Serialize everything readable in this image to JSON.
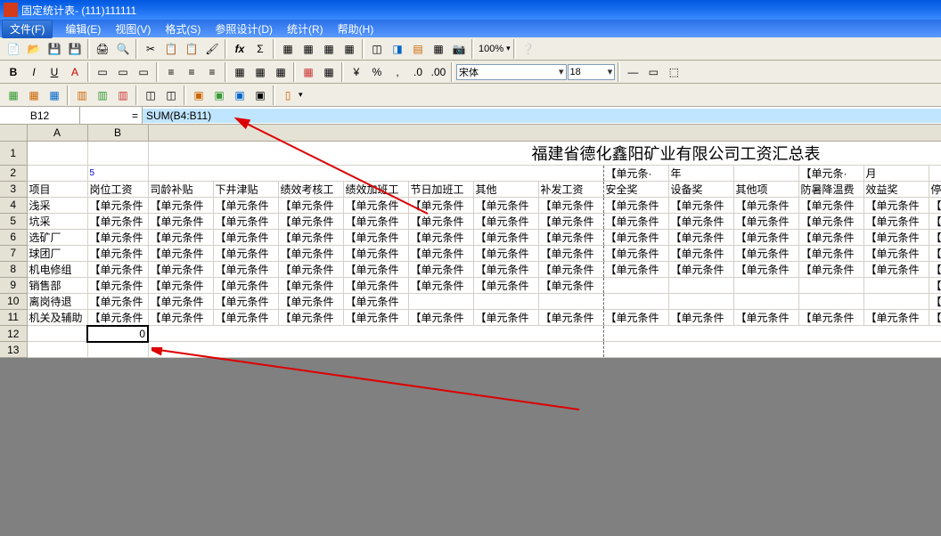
{
  "window": {
    "title": "固定统计表- (111)111111"
  },
  "menus": {
    "file": "文件(F)",
    "items": [
      "编辑(E)",
      "视图(V)",
      "格式(S)",
      "参照设计(D)",
      "统计(R)",
      "帮助(H)"
    ]
  },
  "toolbar2": {
    "font": "宋体",
    "size": "18",
    "zoom": "100%"
  },
  "formula": {
    "cellref": "B12",
    "eq": "=",
    "text": "SUM(B4:B11)"
  },
  "colLetters": [
    "A",
    "B"
  ],
  "rowCount": 13,
  "sheetTitle": "福建省德化鑫阳矿业有限公司工资汇总表",
  "row2": {
    "k": "【单元条·",
    "l": "年",
    "n": "【单元条·",
    "o": "月"
  },
  "headers": [
    "项目",
    "岗位工资",
    "司龄补贴",
    "下井津贴",
    "绩效考核工",
    "绩效加班工",
    "节日加班工",
    "其他",
    "补发工资",
    "安全奖",
    "设备奖",
    "其他项",
    "防暑降温费",
    "效益奖",
    "停"
  ],
  "itemsColA": [
    "浅采",
    "坑采",
    "选矿厂",
    "球团厂",
    "机电修组",
    "销售部",
    "离岗待退",
    "机关及辅助"
  ],
  "cellText": "【单元条件",
  "b2": "5",
  "b12": "0",
  "rows": {
    "4": [
      1,
      1,
      1,
      1,
      1,
      1,
      1,
      1,
      1,
      1,
      1,
      1,
      1,
      1
    ],
    "5": [
      1,
      1,
      1,
      1,
      1,
      1,
      1,
      1,
      1,
      1,
      1,
      1,
      1,
      1
    ],
    "6": [
      1,
      1,
      1,
      1,
      1,
      1,
      1,
      1,
      1,
      1,
      1,
      1,
      1,
      1
    ],
    "7": [
      1,
      1,
      1,
      1,
      1,
      1,
      1,
      1,
      1,
      1,
      1,
      1,
      1,
      1
    ],
    "8": [
      1,
      1,
      1,
      1,
      1,
      1,
      1,
      1,
      1,
      1,
      1,
      1,
      1,
      1
    ],
    "9": [
      1,
      1,
      1,
      1,
      1,
      1,
      1,
      1,
      0,
      0,
      0,
      0,
      0,
      1
    ],
    "10": [
      1,
      1,
      1,
      1,
      1,
      0,
      0,
      0,
      0,
      0,
      0,
      0,
      0,
      1
    ],
    "11": [
      1,
      1,
      1,
      1,
      1,
      1,
      1,
      1,
      1,
      1,
      1,
      1,
      1,
      1
    ]
  }
}
